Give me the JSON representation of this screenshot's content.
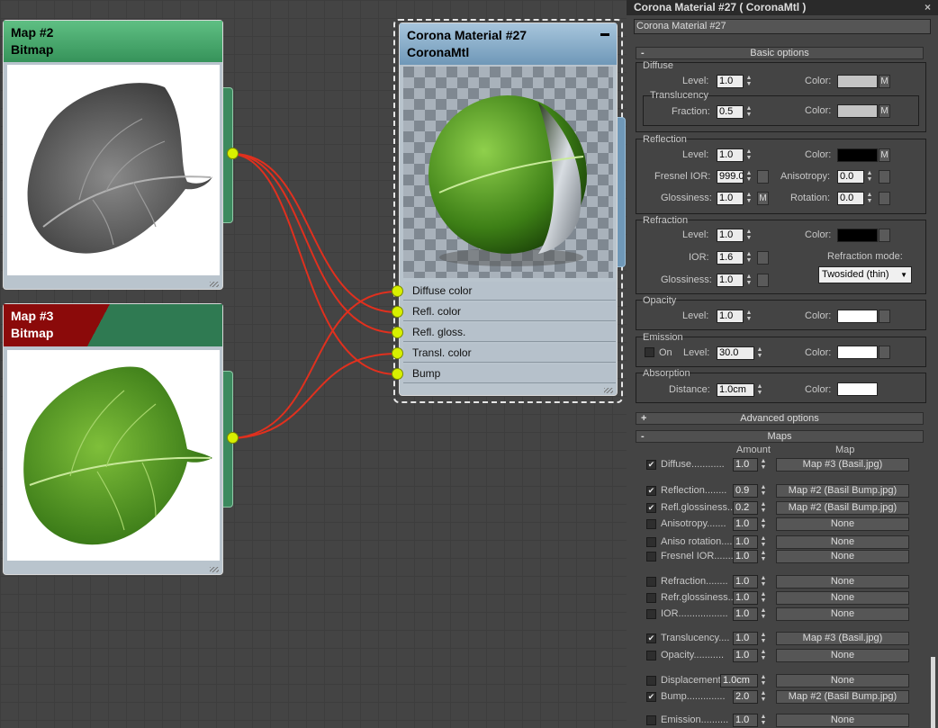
{
  "nodes": {
    "map2": {
      "title": "Map #2",
      "subtitle": "Bitmap"
    },
    "map3": {
      "title": "Map #3",
      "subtitle": "Bitmap"
    },
    "material": {
      "title": "Corona Material #27",
      "subtitle": "CoronaMtl",
      "minimize": "▬",
      "slots": [
        "Diffuse color",
        "Refl. color",
        "Refl. gloss.",
        "Transl. color",
        "Bump"
      ]
    }
  },
  "panel": {
    "title": "Corona Material #27  ( CoronaMtl )",
    "close": "×",
    "name_value": "Corona Material #27",
    "basic_options": "Basic options",
    "diffuse": {
      "header": "Diffuse",
      "level_label": "Level:",
      "level": "1.0",
      "color_label": "Color:",
      "color": "#c4c4c4",
      "m": "M",
      "translucency": "Translucency",
      "fraction_label": "Fraction:",
      "fraction": "0.5",
      "tcolor_label": "Color:",
      "tcolor": "#c4c4c4"
    },
    "reflection": {
      "header": "Reflection",
      "level_label": "Level:",
      "level": "1.0",
      "color_label": "Color:",
      "color": "#000000",
      "m": "M",
      "fresnel_label": "Fresnel IOR:",
      "fresnel": "999.0",
      "aniso_label": "Anisotropy:",
      "aniso": "0.0",
      "gloss_label": "Glossiness:",
      "gloss": "1.0",
      "rot_label": "Rotation:",
      "rot": "0.0"
    },
    "refraction": {
      "header": "Refraction",
      "level_label": "Level:",
      "level": "1.0",
      "color_label": "Color:",
      "color": "#000000",
      "ior_label": "IOR:",
      "ior": "1.6",
      "mode_label": "Refraction mode:",
      "mode": "Twosided (thin)",
      "gloss_label": "Glossiness:",
      "gloss": "1.0"
    },
    "opacity": {
      "header": "Opacity",
      "level_label": "Level:",
      "level": "1.0",
      "color_label": "Color:",
      "color": "#ffffff"
    },
    "emission": {
      "header": "Emission",
      "on_label": "On",
      "level_label": "Level:",
      "level": "30.0",
      "color_label": "Color:",
      "color": "#ffffff"
    },
    "absorption": {
      "header": "Absorption",
      "dist_label": "Distance:",
      "dist": "1.0cm",
      "color_label": "Color:",
      "color": "#ffffff"
    },
    "advanced_options": "Advanced options",
    "maps": {
      "header": "Maps",
      "amount_header": "Amount",
      "map_header": "Map",
      "rows": [
        {
          "checked": true,
          "label": "Diffuse............",
          "amount": "1.0",
          "map": "Map #3 (Basil.jpg)"
        },
        {
          "checked": true,
          "label": "Reflection........",
          "amount": "0.9",
          "map": "Map #2 (Basil Bump.jpg)"
        },
        {
          "checked": true,
          "label": "Refl.glossiness..",
          "amount": "0.2",
          "map": "Map #2 (Basil Bump.jpg)"
        },
        {
          "checked": false,
          "label": "Anisotropy.......",
          "amount": "1.0",
          "map": "None"
        },
        {
          "checked": false,
          "label": "Aniso rotation....",
          "amount": "1.0",
          "map": "None"
        },
        {
          "checked": false,
          "label": "Fresnel IOR.......",
          "amount": "1.0",
          "map": "None"
        },
        {
          "checked": false,
          "label": "Refraction........",
          "amount": "1.0",
          "map": "None"
        },
        {
          "checked": false,
          "label": "Refr.glossiness..",
          "amount": "1.0",
          "map": "None"
        },
        {
          "checked": false,
          "label": "IOR..................",
          "amount": "1.0",
          "map": "None"
        },
        {
          "checked": true,
          "label": "Translucency....",
          "amount": "1.0",
          "map": "Map #3 (Basil.jpg)"
        },
        {
          "checked": false,
          "label": "Opacity...........",
          "amount": "1.0",
          "map": "None"
        },
        {
          "checked": false,
          "label": "Displacement",
          "amount": "1.0cm",
          "map": "None"
        },
        {
          "checked": true,
          "label": "Bump..............",
          "amount": "2.0",
          "map": "Map #2 (Basil Bump.jpg)"
        },
        {
          "checked": false,
          "label": "Emission..........",
          "amount": "1.0",
          "map": "None"
        }
      ]
    }
  },
  "colors": {
    "wire": "#e0301e",
    "socket": "#d8f000",
    "map2_header": "#3c9a5f",
    "map3_header_red": "#8b0a0a",
    "map3_header_green": "#2f7a52",
    "material_header": "#7fa6c4"
  }
}
